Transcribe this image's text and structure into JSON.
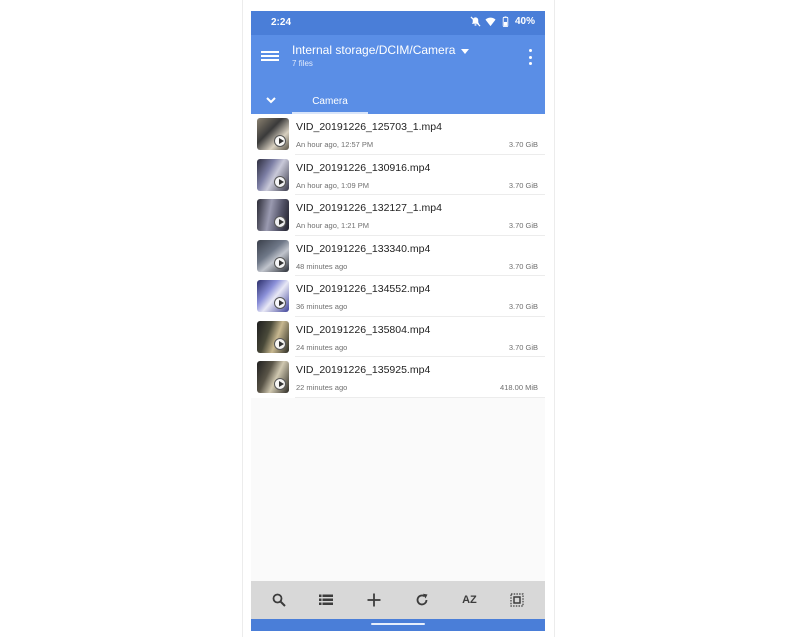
{
  "status_bar": {
    "time": "2:24",
    "battery": "40%",
    "icons": [
      "mute-icon",
      "wifi-icon",
      "battery-icon"
    ]
  },
  "toolbar": {
    "title": "Internal storage/DCIM/Camera",
    "subtitle": "7 files",
    "menu_icon": "hamburger-menu-icon",
    "more_icon": "more-vert-icon"
  },
  "tabs": [
    {
      "label": "Camera",
      "selected": true
    }
  ],
  "files": [
    {
      "name": "VID_20191226_125703_1.mp4",
      "date": "An hour ago, 12:57 PM",
      "size": "3.70 GiB"
    },
    {
      "name": "VID_20191226_130916.mp4",
      "date": "An hour ago, 1:09 PM",
      "size": "3.70 GiB"
    },
    {
      "name": "VID_20191226_132127_1.mp4",
      "date": "An hour ago, 1:21 PM",
      "size": "3.70 GiB"
    },
    {
      "name": "VID_20191226_133340.mp4",
      "date": "48 minutes ago",
      "size": "3.70 GiB"
    },
    {
      "name": "VID_20191226_134552.mp4",
      "date": "36 minutes ago",
      "size": "3.70 GiB"
    },
    {
      "name": "VID_20191226_135804.mp4",
      "date": "24 minutes ago",
      "size": "3.70 GiB"
    },
    {
      "name": "VID_20191226_135925.mp4",
      "date": "22 minutes ago",
      "size": "418.00 MiB"
    }
  ],
  "bottom_bar": {
    "sort_label": "AZ",
    "icons": [
      "search-icon",
      "list-view-icon",
      "add-icon",
      "refresh-icon",
      "sort-icon",
      "select-all-icon"
    ]
  },
  "colors": {
    "status_bar": "#4a7ed8",
    "toolbar": "#5a8ee6",
    "bottom_bar": "#d8d8d8"
  }
}
